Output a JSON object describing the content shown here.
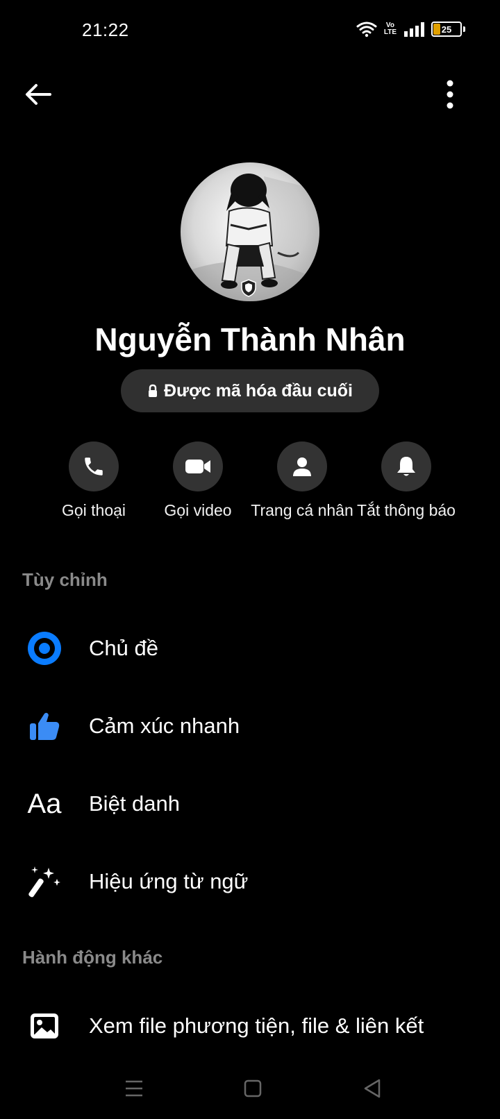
{
  "status_bar": {
    "time": "21:22",
    "volte_top": "Vo",
    "volte_bottom": "LTE",
    "battery": "25"
  },
  "top_bar": {
    "back_icon": "arrow-left-icon",
    "more_icon": "more-vertical-icon"
  },
  "profile": {
    "name": "Nguyễn Thành Nhân",
    "encryption_label": "Được mã hóa đầu cuối"
  },
  "actions": [
    {
      "label": "Gọi thoại",
      "icon": "phone-icon"
    },
    {
      "label": "Gọi video",
      "icon": "video-icon"
    },
    {
      "label": "Trang cá nhân",
      "icon": "person-icon"
    },
    {
      "label": "Tắt thông báo",
      "icon": "bell-icon"
    }
  ],
  "sections": {
    "customize": {
      "title": "Tùy chỉnh",
      "items": [
        {
          "label": "Chủ đề",
          "icon": "theme-icon"
        },
        {
          "label": "Cảm xúc nhanh",
          "icon": "thumbs-up-icon"
        },
        {
          "label": "Biệt danh",
          "icon": "nickname-icon",
          "icon_text": "Aa"
        },
        {
          "label": "Hiệu ứng từ ngữ",
          "icon": "magic-wand-icon"
        }
      ]
    },
    "other_actions": {
      "title": "Hành động khác",
      "items": [
        {
          "label": "Xem file phương tiện, file & liên kết",
          "icon": "image-icon"
        }
      ]
    }
  },
  "colors": {
    "background": "#000000",
    "accent": "#0a7cff",
    "circle_bg": "#333333",
    "section_header": "#8a8a8a"
  }
}
